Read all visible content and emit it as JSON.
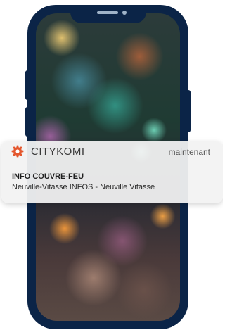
{
  "notification": {
    "app_name": "CITYKOMI",
    "app_icon": "gear-icon",
    "time": "maintenant",
    "title": "INFO COUVRE-FEU",
    "body": "Neuville-Vitasse INFOS - Neuville Vitasse"
  },
  "colors": {
    "phone_frame": "#0b2447",
    "app_icon": "#e4572e",
    "notification_bg": "#f2f2f2"
  }
}
